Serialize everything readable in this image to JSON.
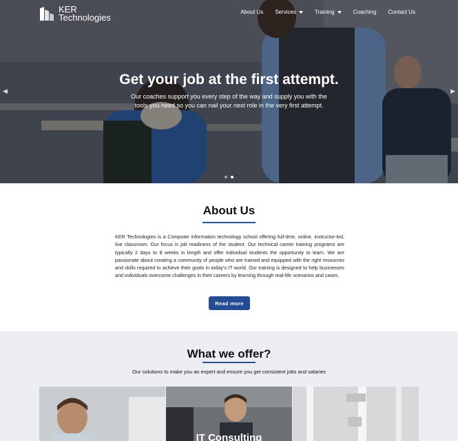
{
  "brand": {
    "name_line1": "KER",
    "name_line2": "Technologies"
  },
  "nav": {
    "items": [
      {
        "label": "About Us",
        "dropdown": false
      },
      {
        "label": "Services",
        "dropdown": true
      },
      {
        "label": "Training",
        "dropdown": true
      },
      {
        "label": "Coaching",
        "dropdown": false
      },
      {
        "label": "Contact Us",
        "dropdown": false
      }
    ]
  },
  "hero": {
    "title": "Get your job at the first attempt.",
    "subtitle": "Our coaches support you every step of the way and supply you with the tools you need so you can nail your next role in the very first attempt.",
    "prev_icon": "chevron-left-icon",
    "next_icon": "chevron-right-icon",
    "slides": 2,
    "active_slide": 2
  },
  "about": {
    "title": "About Us",
    "body": "KER Technologies is a Computer information technology school offering full-time, online, instructor-led, live classroom. Our focus is job readiness of the student. Our technical career training programs are typically 2 days to 8 weeks in length and offer individual students the opportunity to learn. We are passionate about creating a community of people who are trained and equipped with the right resources and skills required to achieve their goals in today's IT world. Our training is designed to help businesses and individuals overcome challenges in their careers by learning through real-life scenarios and cases.",
    "button": "Read more"
  },
  "offer": {
    "title": "What we offer?",
    "subtitle": "Our solutions to make you an expert and ensure you get consistent jobs and salaries",
    "cards": [
      {
        "label": ""
      },
      {
        "label": "IT Consulting"
      },
      {
        "label": ""
      }
    ]
  },
  "colors": {
    "accent": "#234c93",
    "underline": "#2c4f91",
    "offer_bg": "#edeef2"
  }
}
